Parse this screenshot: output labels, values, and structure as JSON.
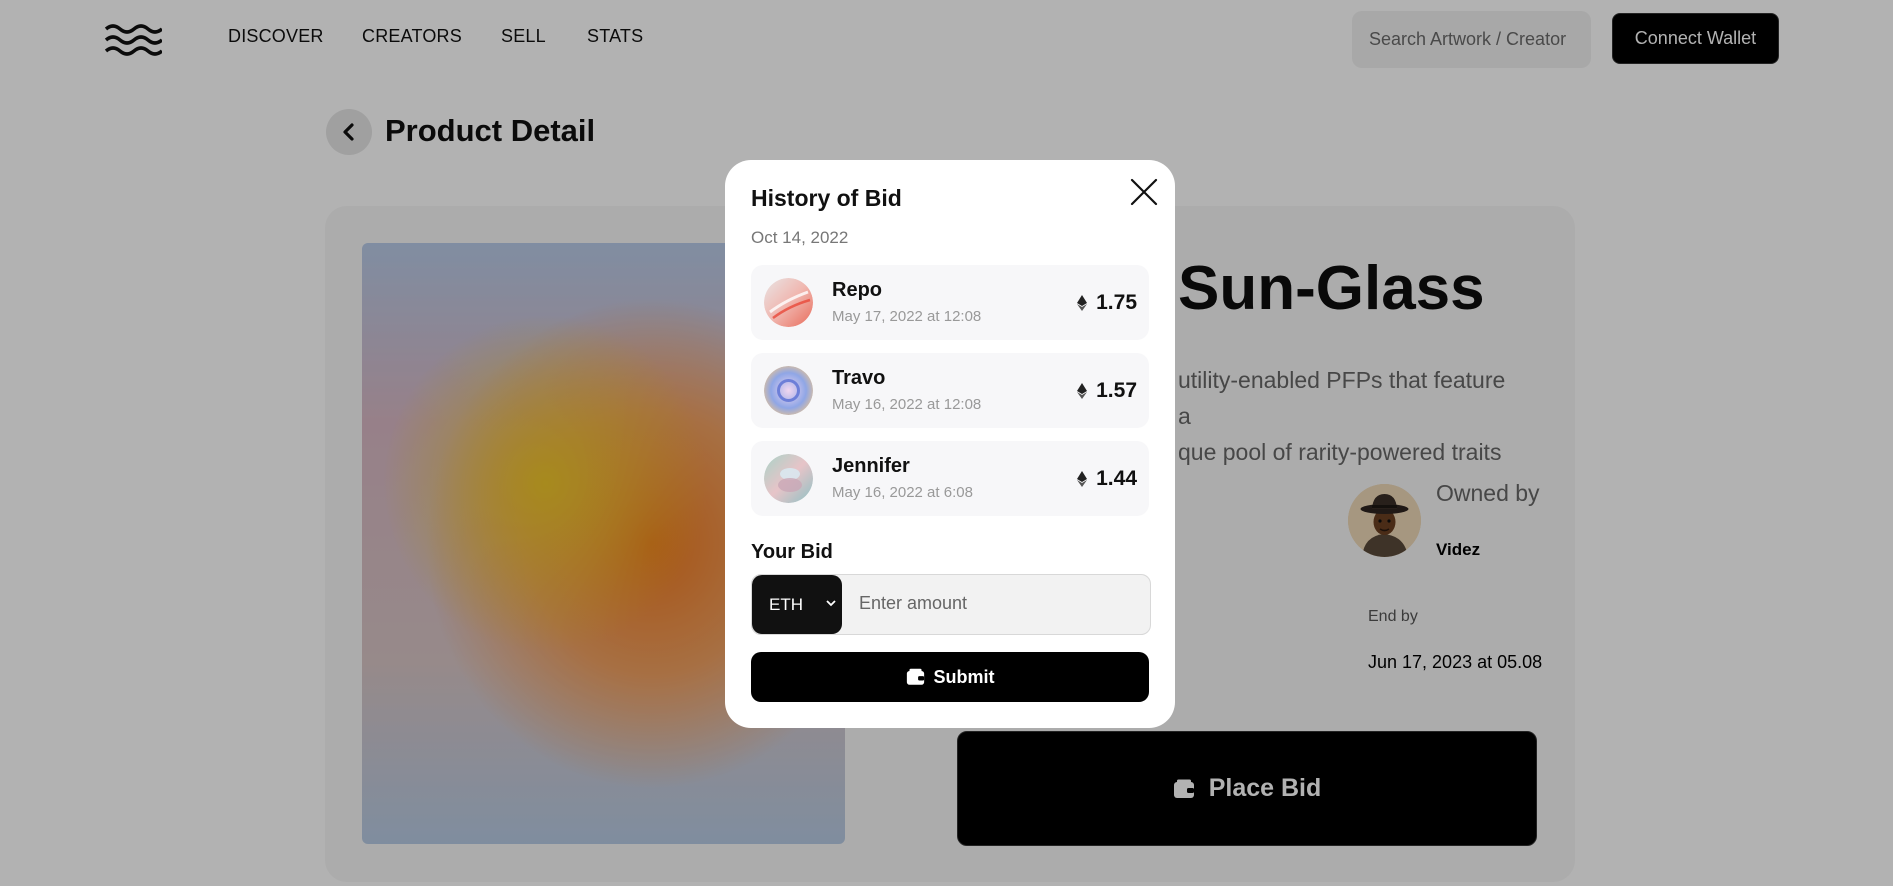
{
  "header": {
    "nav": [
      "DISCOVER",
      "CREATORS",
      "SELL",
      "STATS"
    ],
    "search_placeholder": "Search Artwork / Creator",
    "connect_label": "Connect Wallet"
  },
  "page": {
    "title": "Product Detail"
  },
  "product": {
    "title": "Sun-Glass",
    "description_lines": [
      "utility-enabled PFPs that feature a",
      "que pool of rarity-powered traits"
    ],
    "owned_label": "Owned by",
    "owner": "Videz",
    "end_label": "End by",
    "end_value": "Jun 17, 2023 at 05.08",
    "place_bid_label": "Place Bid"
  },
  "modal": {
    "title": "History of Bid",
    "date": "Oct 14, 2022",
    "bids": [
      {
        "name": "Repo",
        "time": "May 17, 2022 at 12:08",
        "amount": "1.75"
      },
      {
        "name": "Travo",
        "time": "May 16, 2022 at 12:08",
        "amount": "1.57"
      },
      {
        "name": "Jennifer",
        "time": "May 16, 2022 at 6:08",
        "amount": "1.44"
      }
    ],
    "your_bid_label": "Your Bid",
    "currency": "ETH",
    "amount_placeholder": "Enter amount",
    "submit_label": "Submit"
  },
  "icons": {
    "logo": "waves-logo-icon",
    "back": "chevron-left-icon",
    "close": "close-icon",
    "eth": "ethereum-icon",
    "wallet": "wallet-icon",
    "currency_chevron": "chevron-down-icon"
  },
  "colors": {
    "primary": "#000000",
    "overlay": "rgba(0,0,0,0.30)",
    "card_bg": "#f7f7f7",
    "row_bg": "#f7f7f9"
  }
}
